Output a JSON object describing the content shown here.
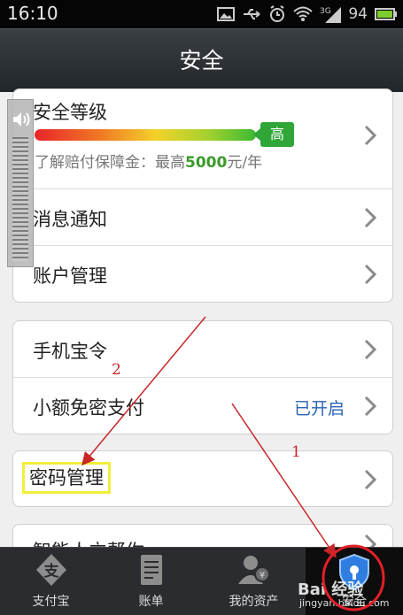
{
  "status_bar": {
    "time": "16:10",
    "network": "3G",
    "battery": "94",
    "icons": [
      "image-icon",
      "usb-icon",
      "alarm-icon",
      "wifi-icon",
      "signal-icon",
      "battery-icon"
    ]
  },
  "header": {
    "title": "安全"
  },
  "security_card": {
    "level_label": "安全等级",
    "level_badge": "高",
    "insurance_prefix": "了解赔付保障金：最高",
    "insurance_amount": "5000",
    "insurance_suffix": "元/年",
    "notify_label": "消息通知",
    "account_label": "账户管理"
  },
  "device_card": {
    "token_label": "手机宝令",
    "small_pay_label": "小额免密支付",
    "small_pay_status": "已开启"
  },
  "password_card": {
    "label": "密码管理"
  },
  "partial_row": {
    "label": "智能人立帮你"
  },
  "bottom_nav": {
    "tabs": [
      {
        "label": "支付宝",
        "icon": "alipay-icon"
      },
      {
        "label": "账单",
        "icon": "bill-icon"
      },
      {
        "label": "我的资产",
        "icon": "assets-icon"
      },
      {
        "label": "安全",
        "icon": "shield-icon"
      }
    ],
    "active_tab": "安全"
  },
  "annotations": {
    "step1": "1",
    "step2": "2"
  },
  "watermark": {
    "brand": "Bai 经验",
    "url": "jingyan.baidu.com"
  },
  "colors": {
    "accent_green": "#2fa637",
    "status_blue": "#2a62b6",
    "annotation_red": "#c8262a",
    "highlight_yellow": "#f2ee3a"
  }
}
